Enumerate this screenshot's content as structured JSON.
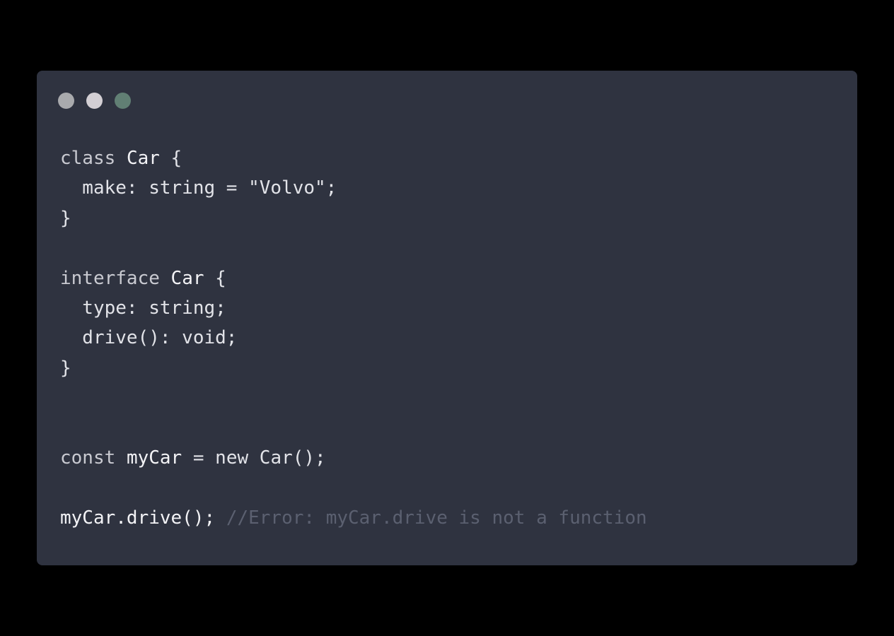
{
  "window_controls": {
    "close_color": "#a9aaad",
    "minimize_color": "#d3cfd4",
    "maximize_color": "#617f74"
  },
  "code": {
    "lines": [
      {
        "kw": "class",
        "sp1": " ",
        "name": "Car",
        "rest": " {"
      },
      {
        "text": "  make: string = \"Volvo\";"
      },
      {
        "text": "}"
      },
      {
        "text": ""
      },
      {
        "kw": "interface",
        "sp1": " ",
        "name": "Car",
        "rest": " {"
      },
      {
        "text": "  type: string;"
      },
      {
        "text": "  drive(): void;"
      },
      {
        "text": "}"
      },
      {
        "text": ""
      },
      {
        "text": ""
      },
      {
        "kw": "const",
        "sp1": " ",
        "name": "myCar",
        "rest": " = new Car();"
      },
      {
        "text": ""
      },
      {
        "text": "myCar.drive(); ",
        "comment": "//Error: myCar.drive is not a function"
      }
    ]
  }
}
